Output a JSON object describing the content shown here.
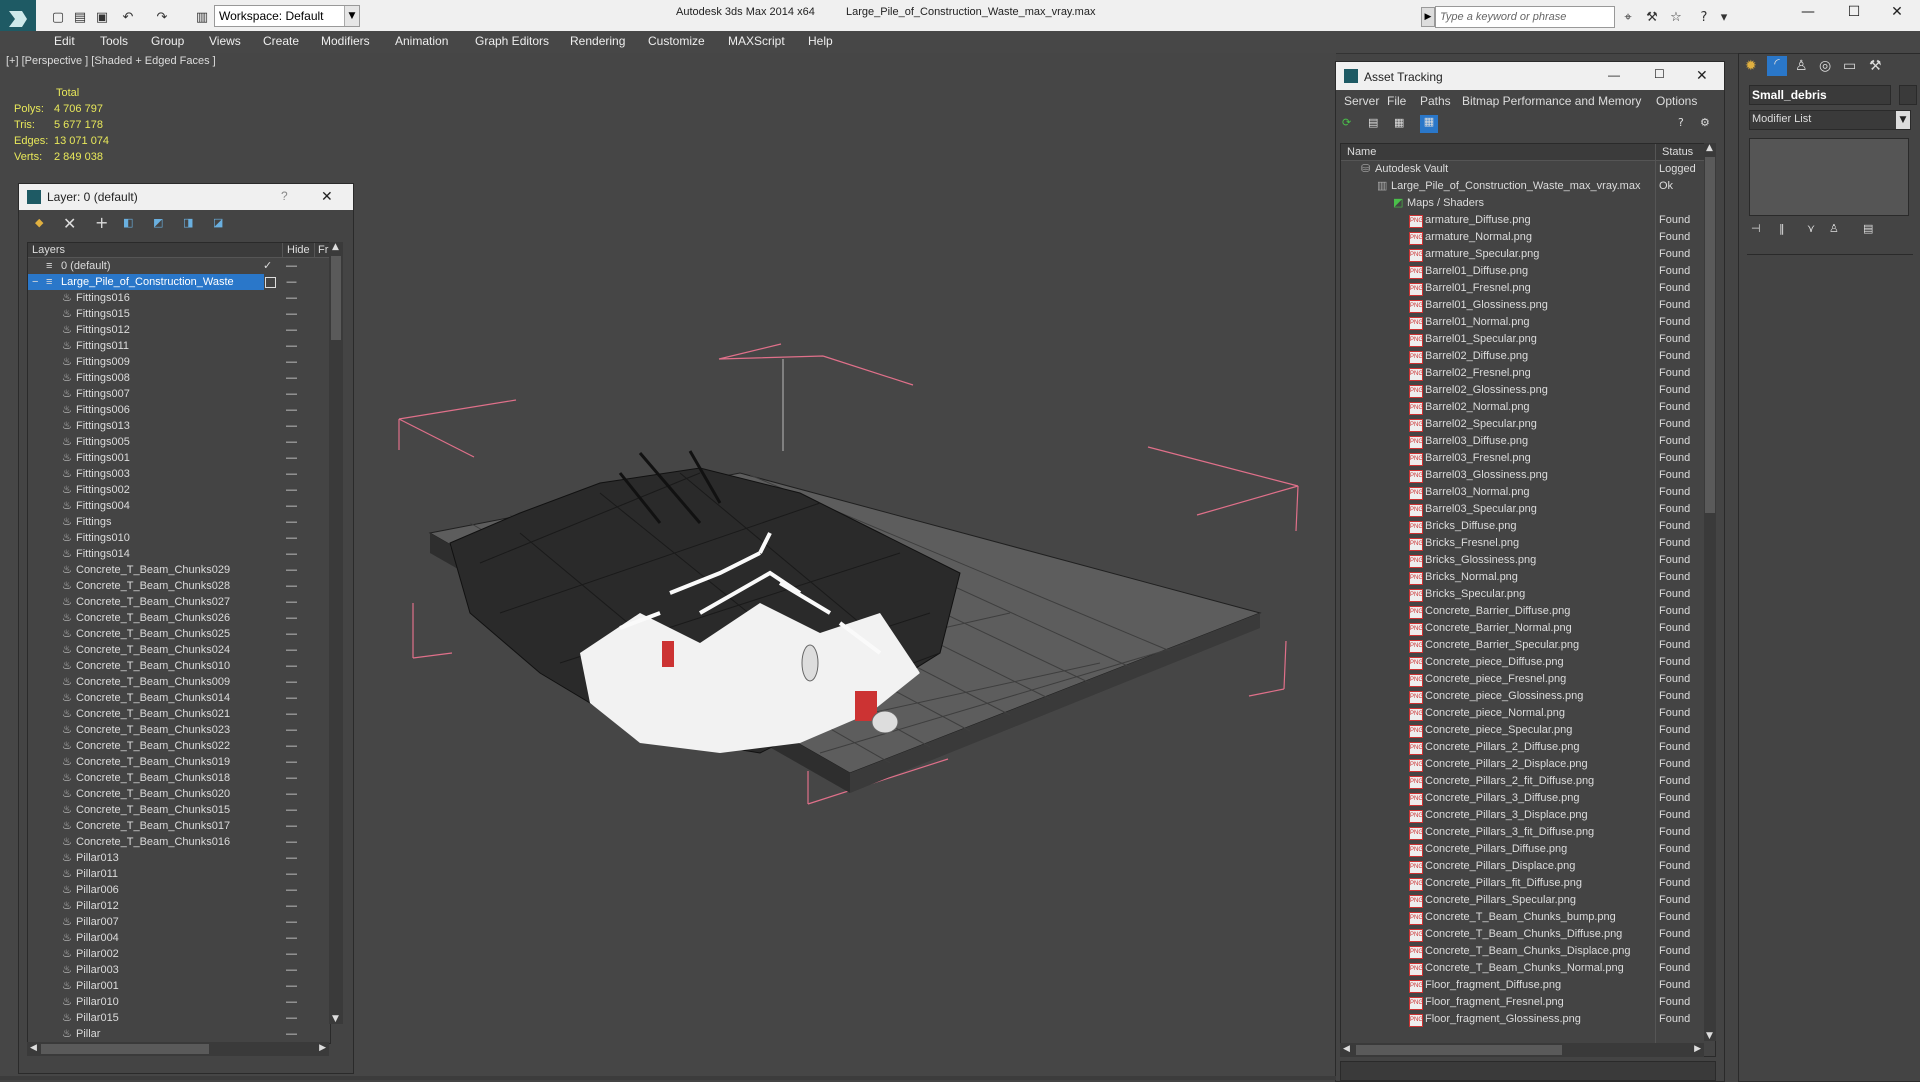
{
  "titlebar": {
    "app_title": "Autodesk 3ds Max  2014 x64",
    "file_title": "Large_Pile_of_Construction_Waste_max_vray.max",
    "workspace": "Workspace: Default",
    "search_placeholder": "Type a keyword or phrase"
  },
  "menu": [
    "Edit",
    "Tools",
    "Group",
    "Views",
    "Create",
    "Modifiers",
    "Animation",
    "Graph Editors",
    "Rendering",
    "Customize",
    "MAXScript",
    "Help"
  ],
  "viewport": {
    "label": "[+] [Perspective ] [Shaded + Edged Faces ]",
    "stats": {
      "header": "Total",
      "rows": [
        {
          "label": "Polys:",
          "value": "4 706 797"
        },
        {
          "label": "Tris:",
          "value": "5 677 178"
        },
        {
          "label": "Edges:",
          "value": "13 071 074"
        },
        {
          "label": "Verts:",
          "value": "2 849 038"
        }
      ]
    }
  },
  "layer_panel": {
    "title": "Layer: 0 (default)",
    "help": "?",
    "columns": {
      "name": "Layers",
      "hide": "Hide",
      "freeze": "Fr"
    },
    "default_layer": "0 (default)",
    "selected_layer": "Large_Pile_of_Construction_Waste",
    "objects": [
      "Fittings016",
      "Fittings015",
      "Fittings012",
      "Fittings011",
      "Fittings009",
      "Fittings008",
      "Fittings007",
      "Fittings006",
      "Fittings013",
      "Fittings005",
      "Fittings001",
      "Fittings003",
      "Fittings002",
      "Fittings004",
      "Fittings",
      "Fittings010",
      "Fittings014",
      "Concrete_T_Beam_Chunks029",
      "Concrete_T_Beam_Chunks028",
      "Concrete_T_Beam_Chunks027",
      "Concrete_T_Beam_Chunks026",
      "Concrete_T_Beam_Chunks025",
      "Concrete_T_Beam_Chunks024",
      "Concrete_T_Beam_Chunks010",
      "Concrete_T_Beam_Chunks009",
      "Concrete_T_Beam_Chunks014",
      "Concrete_T_Beam_Chunks021",
      "Concrete_T_Beam_Chunks023",
      "Concrete_T_Beam_Chunks022",
      "Concrete_T_Beam_Chunks019",
      "Concrete_T_Beam_Chunks018",
      "Concrete_T_Beam_Chunks020",
      "Concrete_T_Beam_Chunks015",
      "Concrete_T_Beam_Chunks017",
      "Concrete_T_Beam_Chunks016",
      "Pillar013",
      "Pillar011",
      "Pillar006",
      "Pillar012",
      "Pillar007",
      "Pillar004",
      "Pillar002",
      "Pillar003",
      "Pillar001",
      "Pillar010",
      "Pillar015",
      "Pillar"
    ]
  },
  "asset_tracking": {
    "title": "Asset Tracking",
    "menu": [
      "Server",
      "File",
      "Paths",
      "Bitmap Performance and Memory",
      "Options"
    ],
    "columns": {
      "name": "Name",
      "status": "Status"
    },
    "vault": {
      "name": "Autodesk Vault",
      "status": "Logged"
    },
    "file": {
      "name": "Large_Pile_of_Construction_Waste_max_vray.max",
      "status": "Ok"
    },
    "group": "Maps / Shaders",
    "maps": [
      {
        "name": "armature_Diffuse.png",
        "status": "Found"
      },
      {
        "name": "armature_Normal.png",
        "status": "Found"
      },
      {
        "name": "armature_Specular.png",
        "status": "Found"
      },
      {
        "name": "Barrel01_Diffuse.png",
        "status": "Found"
      },
      {
        "name": "Barrel01_Fresnel.png",
        "status": "Found"
      },
      {
        "name": "Barrel01_Glossiness.png",
        "status": "Found"
      },
      {
        "name": "Barrel01_Normal.png",
        "status": "Found"
      },
      {
        "name": "Barrel01_Specular.png",
        "status": "Found"
      },
      {
        "name": "Barrel02_Diffuse.png",
        "status": "Found"
      },
      {
        "name": "Barrel02_Fresnel.png",
        "status": "Found"
      },
      {
        "name": "Barrel02_Glossiness.png",
        "status": "Found"
      },
      {
        "name": "Barrel02_Normal.png",
        "status": "Found"
      },
      {
        "name": "Barrel02_Specular.png",
        "status": "Found"
      },
      {
        "name": "Barrel03_Diffuse.png",
        "status": "Found"
      },
      {
        "name": "Barrel03_Fresnel.png",
        "status": "Found"
      },
      {
        "name": "Barrel03_Glossiness.png",
        "status": "Found"
      },
      {
        "name": "Barrel03_Normal.png",
        "status": "Found"
      },
      {
        "name": "Barrel03_Specular.png",
        "status": "Found"
      },
      {
        "name": "Bricks_Diffuse.png",
        "status": "Found"
      },
      {
        "name": "Bricks_Fresnel.png",
        "status": "Found"
      },
      {
        "name": "Bricks_Glossiness.png",
        "status": "Found"
      },
      {
        "name": "Bricks_Normal.png",
        "status": "Found"
      },
      {
        "name": "Bricks_Specular.png",
        "status": "Found"
      },
      {
        "name": "Concrete_Barrier_Diffuse.png",
        "status": "Found"
      },
      {
        "name": "Concrete_Barrier_Normal.png",
        "status": "Found"
      },
      {
        "name": "Concrete_Barrier_Specular.png",
        "status": "Found"
      },
      {
        "name": "Concrete_piece_Diffuse.png",
        "status": "Found"
      },
      {
        "name": "Concrete_piece_Fresnel.png",
        "status": "Found"
      },
      {
        "name": "Concrete_piece_Glossiness.png",
        "status": "Found"
      },
      {
        "name": "Concrete_piece_Normal.png",
        "status": "Found"
      },
      {
        "name": "Concrete_piece_Specular.png",
        "status": "Found"
      },
      {
        "name": "Concrete_Pillars_2_Diffuse.png",
        "status": "Found"
      },
      {
        "name": "Concrete_Pillars_2_Displace.png",
        "status": "Found"
      },
      {
        "name": "Concrete_Pillars_2_fit_Diffuse.png",
        "status": "Found"
      },
      {
        "name": "Concrete_Pillars_3_Diffuse.png",
        "status": "Found"
      },
      {
        "name": "Concrete_Pillars_3_Displace.png",
        "status": "Found"
      },
      {
        "name": "Concrete_Pillars_3_fit_Diffuse.png",
        "status": "Found"
      },
      {
        "name": "Concrete_Pillars_Diffuse.png",
        "status": "Found"
      },
      {
        "name": "Concrete_Pillars_Displace.png",
        "status": "Found"
      },
      {
        "name": "Concrete_Pillars_fit_Diffuse.png",
        "status": "Found"
      },
      {
        "name": "Concrete_Pillars_Specular.png",
        "status": "Found"
      },
      {
        "name": "Concrete_T_Beam_Chunks_bump.png",
        "status": "Found"
      },
      {
        "name": "Concrete_T_Beam_Chunks_Diffuse.png",
        "status": "Found"
      },
      {
        "name": "Concrete_T_Beam_Chunks_Displace.png",
        "status": "Found"
      },
      {
        "name": "Concrete_T_Beam_Chunks_Normal.png",
        "status": "Found"
      },
      {
        "name": "Floor_fragment_Diffuse.png",
        "status": "Found"
      },
      {
        "name": "Floor_fragment_Fresnel.png",
        "status": "Found"
      },
      {
        "name": "Floor_fragment_Glossiness.png",
        "status": "Found"
      }
    ]
  },
  "command_panel": {
    "object_name": "Small_debris",
    "modifier_list": "Modifier List"
  }
}
